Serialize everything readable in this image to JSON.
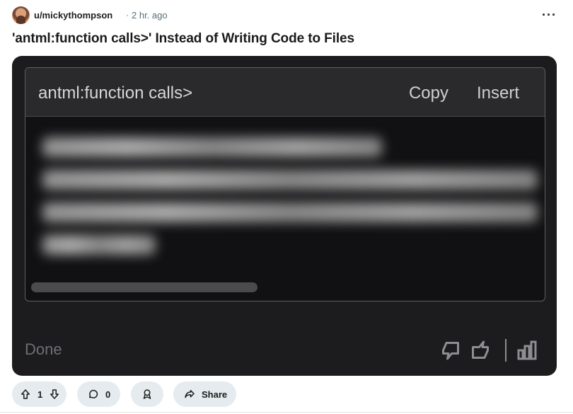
{
  "post": {
    "username": "u/mickythompson",
    "separator": "·",
    "time": "2 hr. ago",
    "menu": "···",
    "title": "'antml:function calls>' Instead of Writing Code to Files"
  },
  "screenshot": {
    "code_title": "antml:function calls>",
    "copy_label": "Copy",
    "insert_label": "Insert",
    "done_label": "Done",
    "icons": [
      "thumbs-down-icon",
      "thumbs-up-icon",
      "chart-icon"
    ]
  },
  "actions": {
    "vote_count": "1",
    "comment_count": "0",
    "share_label": "Share"
  },
  "colors": {
    "accent_dark": "#1c1c1e",
    "pill_bg": "#e5ebee"
  }
}
